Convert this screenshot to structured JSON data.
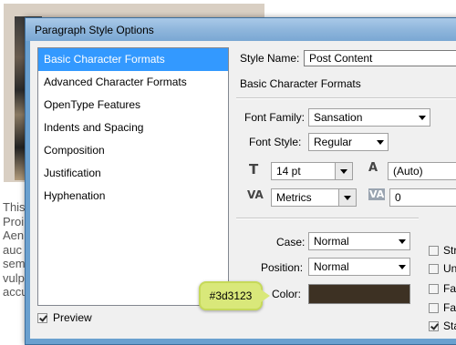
{
  "background": {
    "text_lines": [
      "This",
      "Proi",
      "Aen",
      "auc",
      "sem",
      "vulp",
      "accu"
    ]
  },
  "dialog": {
    "title": "Paragraph Style Options",
    "categories": [
      {
        "label": "Basic Character Formats",
        "selected": true
      },
      {
        "label": "Advanced Character Formats"
      },
      {
        "label": "OpenType Features"
      },
      {
        "label": "Indents and Spacing"
      },
      {
        "label": "Composition"
      },
      {
        "label": "Justification"
      },
      {
        "label": "Hyphenation"
      }
    ],
    "preview": {
      "label": "Preview",
      "checked": true
    },
    "style_name": {
      "label": "Style Name:",
      "value": "Post Content"
    },
    "section_title": "Basic Character Formats",
    "font_family": {
      "label": "Font Family:",
      "value": "Sansation"
    },
    "font_style": {
      "label": "Font Style:",
      "value": "Regular"
    },
    "font_size": {
      "value": "14 pt",
      "icon": "font-size-icon"
    },
    "leading": {
      "value": "(Auto)",
      "icon": "leading-icon"
    },
    "kerning": {
      "value": "Metrics",
      "icon": "kerning-icon"
    },
    "tracking": {
      "value": "0",
      "icon": "tracking-icon"
    },
    "case": {
      "label": "Case:",
      "value": "Normal"
    },
    "position": {
      "label": "Position:",
      "value": "Normal"
    },
    "color": {
      "label": "Color:",
      "value_hex": "#3d3123"
    },
    "checkboxes": [
      {
        "label": "Stri",
        "checked": false
      },
      {
        "label": "Unc",
        "checked": false
      },
      {
        "label": "Fau",
        "checked": false
      },
      {
        "label": "Fau",
        "checked": false
      },
      {
        "label": "Sta",
        "checked": true
      }
    ]
  },
  "callout": {
    "text": "#3d3123"
  }
}
